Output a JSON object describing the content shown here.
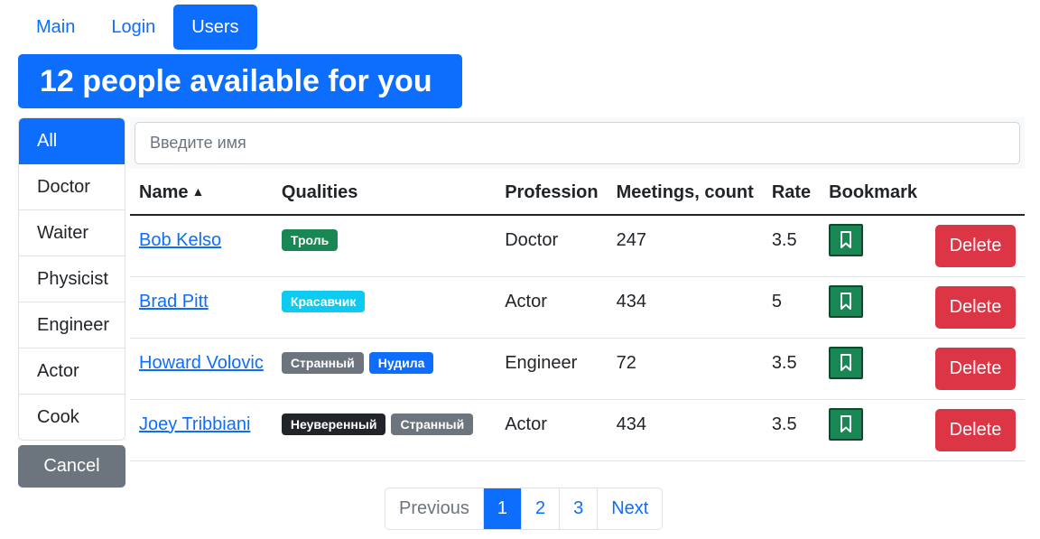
{
  "nav": {
    "items": [
      {
        "label": "Main"
      },
      {
        "label": "Login"
      },
      {
        "label": "Users",
        "active": true
      }
    ]
  },
  "header": {
    "title": "12 people available for you",
    "color": "#0d6efd"
  },
  "professions": {
    "items": [
      "All",
      "Doctor",
      "Waiter",
      "Physicist",
      "Engineer",
      "Actor",
      "Cook"
    ],
    "active": "All",
    "cancel_label": "Cancel"
  },
  "search": {
    "placeholder": "Введите имя",
    "value": ""
  },
  "table": {
    "columns": [
      "Name",
      "Qualities",
      "Profession",
      "Meetings, count",
      "Rate",
      "Bookmark",
      ""
    ],
    "sort": {
      "column": "Name",
      "direction": "asc",
      "icon": "caret-up-icon"
    },
    "rows": [
      {
        "name": "Bob Kelso",
        "qualities": [
          {
            "label": "Троль",
            "color": "#198754"
          }
        ],
        "profession": "Doctor",
        "meetings": "247",
        "rate": "3.5",
        "delete_label": "Delete"
      },
      {
        "name": "Brad Pitt",
        "qualities": [
          {
            "label": "Красавчик",
            "color": "#0dcaf0"
          }
        ],
        "profession": "Actor",
        "meetings": "434",
        "rate": "5",
        "delete_label": "Delete"
      },
      {
        "name": "Howard Volovic",
        "qualities": [
          {
            "label": "Странный",
            "color": "#6c757d"
          },
          {
            "label": "Нудила",
            "color": "#0d6efd"
          }
        ],
        "profession": "Engineer",
        "meetings": "72",
        "rate": "3.5",
        "delete_label": "Delete"
      },
      {
        "name": "Joey Tribbiani",
        "qualities": [
          {
            "label": "Неуверенный",
            "color": "#212529"
          },
          {
            "label": "Странный",
            "color": "#6c757d"
          }
        ],
        "profession": "Actor",
        "meetings": "434",
        "rate": "3.5",
        "delete_label": "Delete"
      }
    ]
  },
  "pagination": {
    "previous_label": "Previous",
    "pages": [
      "1",
      "2",
      "3"
    ],
    "current": "1",
    "next_label": "Next"
  },
  "colors": {
    "primary": "#0d6efd",
    "danger": "#dc3545",
    "success": "#198754",
    "secondary": "#6c757d"
  }
}
